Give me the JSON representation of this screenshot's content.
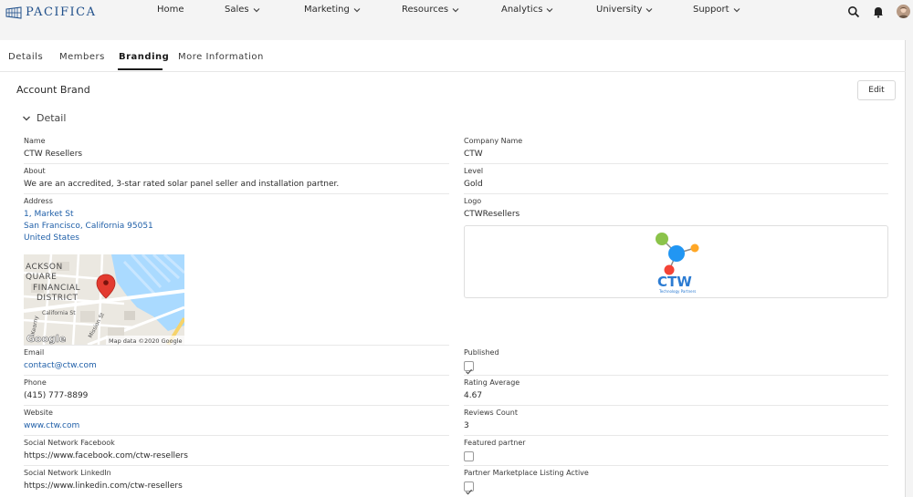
{
  "header": {
    "brand": "PACIFICA",
    "nav": [
      {
        "label": "Home",
        "has_menu": false
      },
      {
        "label": "Sales",
        "has_menu": true
      },
      {
        "label": "Marketing",
        "has_menu": true
      },
      {
        "label": "Resources",
        "has_menu": true
      },
      {
        "label": "Analytics",
        "has_menu": true
      },
      {
        "label": "University",
        "has_menu": true
      },
      {
        "label": "Support",
        "has_menu": true
      }
    ],
    "icons": [
      "search-icon",
      "notification-bell-icon",
      "user-avatar"
    ]
  },
  "tabs": [
    {
      "label": "Details",
      "active": false
    },
    {
      "label": "Members",
      "active": false
    },
    {
      "label": "Branding",
      "active": true
    },
    {
      "label": "More Information",
      "active": false
    }
  ],
  "section": {
    "title": "Account Brand",
    "edit_label": "Edit",
    "detail_label": "Detail"
  },
  "fields": {
    "name": {
      "label": "Name",
      "value": "CTW Resellers"
    },
    "company_name": {
      "label": "Company Name",
      "value": "CTW"
    },
    "about": {
      "label": "About",
      "value": "We are an accredited, 3-star rated solar panel seller and installation partner."
    },
    "level": {
      "label": "Level",
      "value": "Gold"
    },
    "address": {
      "label": "Address",
      "line1": "1, Market St",
      "line2": "San Francisco, California 95051",
      "line3": "United States"
    },
    "logo": {
      "label": "Logo",
      "value": "CTWResellers"
    },
    "email": {
      "label": "Email",
      "value": "contact@ctw.com"
    },
    "published": {
      "label": "Published",
      "checked": true
    },
    "phone": {
      "label": "Phone",
      "value": "(415) 777-8899"
    },
    "rating_average": {
      "label": "Rating Average",
      "value": "4.67"
    },
    "website": {
      "label": "Website",
      "value": "www.ctw.com"
    },
    "reviews_count": {
      "label": "Reviews Count",
      "value": "3"
    },
    "facebook": {
      "label": "Social Network Facebook",
      "value": "https://www.facebook.com/ctw-resellers"
    },
    "featured_partner": {
      "label": "Featured partner",
      "checked": false
    },
    "linkedin": {
      "label": "Social Network LinkedIn",
      "value": "https://www.linkedin.com/ctw-resellers"
    },
    "marketplace_active": {
      "label": "Partner Marketplace Listing Active",
      "checked": true
    }
  },
  "map": {
    "labels": {
      "jackson": "ACKSON",
      "square": "QUARE",
      "financial": "FINANCIAL",
      "district": "DISTRICT",
      "california": "California St",
      "mission": "Mission St",
      "street_left": "Kearny"
    },
    "google": "Google",
    "attribution": "Map data ©2020 Google"
  },
  "logo_image": {
    "text": "CTW",
    "tagline": "Technology Partners"
  },
  "colors": {
    "link": "#1f5fa8",
    "brand": "#1f4f8a",
    "map_water": "#aadaff",
    "map_land": "#ebe8e1",
    "pin": "#e33b30",
    "logo_text": "#2b7bd2"
  }
}
